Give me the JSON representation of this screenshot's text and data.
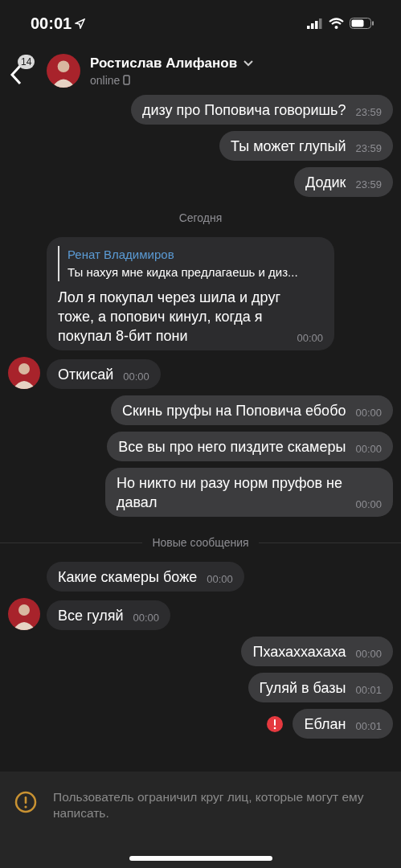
{
  "status_bar": {
    "time": "00:01"
  },
  "header": {
    "unread_count": "14",
    "name": "Ростислав Алифанов",
    "status": "online"
  },
  "messages": [
    {
      "kind": "out",
      "text": "дизу про Поповича говоришь?",
      "time": "23:59",
      "failed": false
    },
    {
      "kind": "out",
      "text": "Ты может глупый",
      "time": "23:59",
      "failed": false
    },
    {
      "kind": "out",
      "text": "Додик",
      "time": "23:59",
      "failed": false
    },
    {
      "kind": "date",
      "text": "Сегодня"
    },
    {
      "kind": "in",
      "avatar": false,
      "reply": {
        "author": "Ренат Владимиров",
        "text": "Ты нахуя мне кидка предлагаешь и диз..."
      },
      "text": "Лол я покупал через шила и друг тоже, а попович кинул, когда я покупал 8-бит пони",
      "time": "00:00"
    },
    {
      "kind": "in",
      "avatar": true,
      "text": "Откисай",
      "time": "00:00"
    },
    {
      "kind": "out",
      "text": "Скинь пруфы на Поповича ебобо",
      "time": "00:00",
      "failed": false
    },
    {
      "kind": "out",
      "text": "Все вы про него пиздите скамеры",
      "time": "00:00",
      "failed": false
    },
    {
      "kind": "out",
      "text": "Но никто ни разу норм пруфов не давал",
      "time": "00:00",
      "failed": false
    },
    {
      "kind": "unread",
      "text": "Новые сообщения"
    },
    {
      "kind": "in",
      "avatar": false,
      "text": "Какие скамеры боже",
      "time": "00:00"
    },
    {
      "kind": "in",
      "avatar": true,
      "text": "Все гуляй",
      "time": "00:00"
    },
    {
      "kind": "out",
      "text": "Пхахаххахаха",
      "time": "00:00",
      "failed": false
    },
    {
      "kind": "out",
      "text": "Гуляй в базы",
      "time": "00:01",
      "failed": false
    },
    {
      "kind": "out",
      "text": "Еблан",
      "time": "00:01",
      "failed": true
    }
  ],
  "notice": {
    "text": "Пользователь ограничил круг лиц, которые могут ему написать."
  }
}
